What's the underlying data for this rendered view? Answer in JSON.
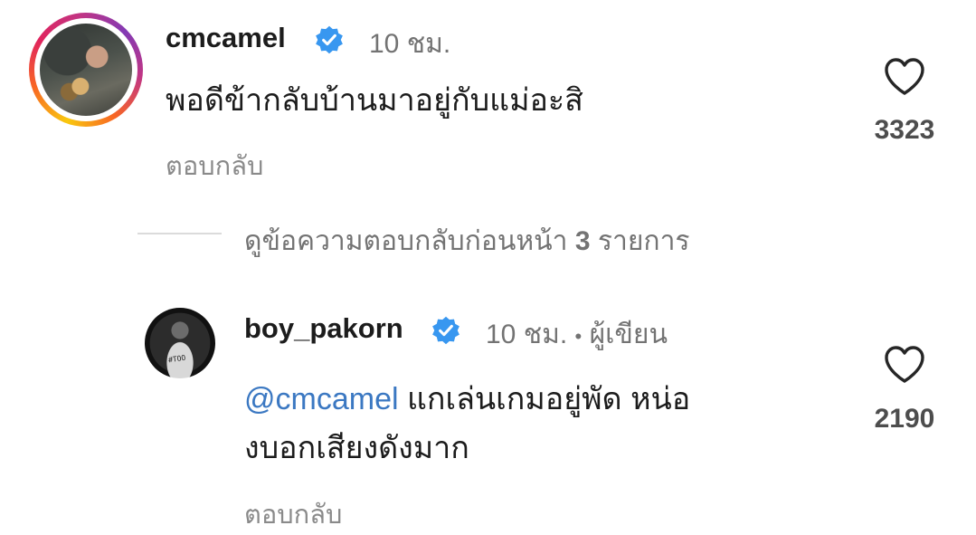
{
  "comment": {
    "username": "cmcamel",
    "time": "10 ชม.",
    "text": "พอดีข้ากลับบ้านมาอยู่กับแม่อะสิ",
    "reply_label": "ตอบกลับ",
    "like_count": "3323",
    "icons": {
      "verified": "verified-badge-icon",
      "like": "heart-icon"
    }
  },
  "view_replies": {
    "prefix": "ดูข้อความตอบกลับก่อนหน้า ",
    "count": "3",
    "suffix": " รายการ"
  },
  "reply": {
    "username": "boy_pakorn",
    "time": "10 ชม.",
    "separator": "•",
    "author_label": "ผู้เขียน",
    "mention": "@cmcamel",
    "text_line1": " แกเล่นเกมอยู่พัด หน่อ",
    "text_line2": "งบอกเสียงดังมาก",
    "reply_label": "ตอบกลับ",
    "like_count": "2190",
    "icons": {
      "verified": "verified-badge-icon",
      "like": "heart-icon"
    }
  },
  "colors": {
    "verified": "#3897f0",
    "mention": "#3b78c2",
    "secondary_text": "#737373"
  }
}
